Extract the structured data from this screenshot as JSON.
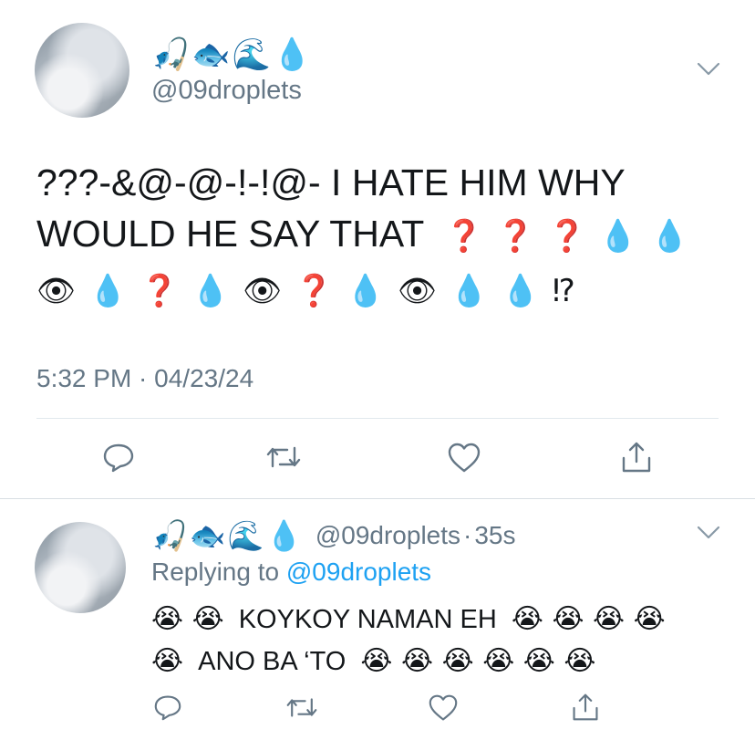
{
  "tweet": {
    "display_name_emoji": "🎣🐟🌊💧",
    "handle": "@09droplets",
    "text_line1": "???-&@-@-!-!@- I HATE HIM WHY",
    "text_line2_words": "WOULD HE SAY THAT",
    "text_line2_emoji": "❓❓❓💧💧",
    "text_line3_emoji": "👁💧❓💧👁❓💧👁💧💧⁉",
    "timestamp": "5:32 PM · 04/23/24"
  },
  "reply": {
    "display_name_emoji": "🎣🐟🌊💧",
    "handle": "@09droplets",
    "separator": "·",
    "age": "35s",
    "replying_prefix": "Replying to ",
    "replying_handle": "@09droplets",
    "line1_pre": "😭 😭",
    "line1_words": "KOYKOY NAMAN EH",
    "line1_post": "😭 😭 😭 😭",
    "line2_pre": "😭",
    "line2_words": "ANO BA ‘TO",
    "line2_post": "😭 😭 😭 😭 😭 😭"
  },
  "icons": {
    "reply": "reply-icon",
    "retweet": "retweet-icon",
    "like": "heart-icon",
    "share": "share-icon",
    "menu": "chevron-down-icon"
  },
  "colors": {
    "text": "#14171a",
    "muted": "#657786",
    "link": "#1da1f2",
    "divider": "#e1e8ed"
  }
}
